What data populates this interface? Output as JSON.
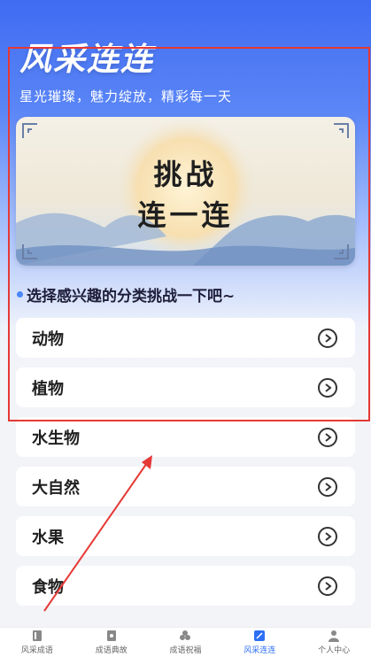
{
  "header": {
    "title": "风采连连",
    "subtitle": "星光璀璨，魅力绽放，精彩每一天"
  },
  "banner": {
    "line1": "挑战",
    "line2": "连一连"
  },
  "prompt": "选择感兴趣的分类挑战一下吧~",
  "categories": [
    {
      "label": "动物"
    },
    {
      "label": "植物"
    },
    {
      "label": "水生物"
    },
    {
      "label": "大自然"
    },
    {
      "label": "水果"
    },
    {
      "label": "食物"
    }
  ],
  "tabbar": [
    {
      "label": "风采成语",
      "icon": "book-icon"
    },
    {
      "label": "成语典故",
      "icon": "scroll-icon"
    },
    {
      "label": "成语祝福",
      "icon": "blessing-icon"
    },
    {
      "label": "风采连连",
      "icon": "link-icon",
      "active": true
    },
    {
      "label": "个人中心",
      "icon": "user-icon"
    }
  ],
  "colors": {
    "accent": "#2f6ff5",
    "header_gradient_top": "#3f6cf2",
    "highlight_box": "#e53935"
  }
}
